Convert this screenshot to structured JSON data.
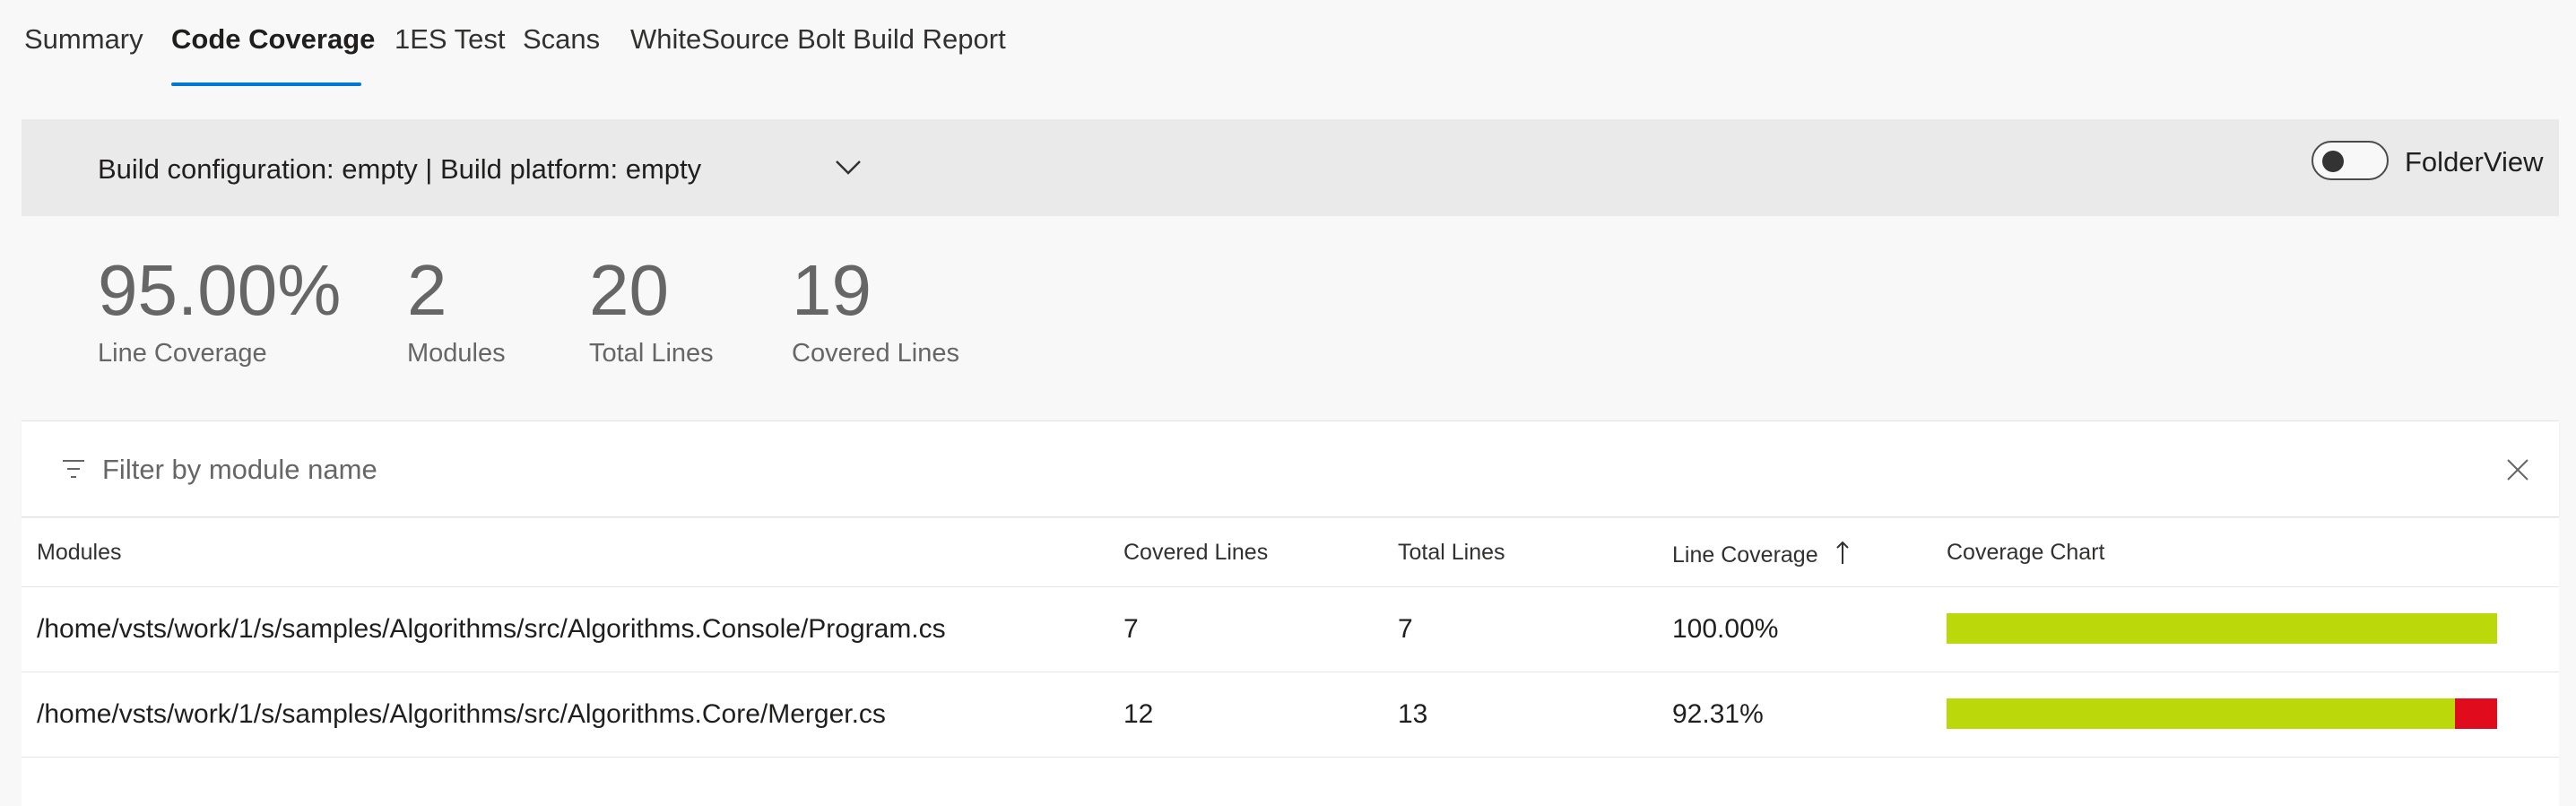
{
  "tabs": [
    {
      "label": "Summary",
      "active": false
    },
    {
      "label": "Code Coverage",
      "active": true
    },
    {
      "label": "1ES Test",
      "active": false
    },
    {
      "label": "Scans",
      "active": false
    },
    {
      "label": "WhiteSource Bolt Build Report",
      "active": false
    }
  ],
  "config": {
    "label": "Build configuration: empty | Build platform: empty",
    "icon": "chevron-down-icon"
  },
  "folder_view": {
    "label": "FolderView",
    "enabled": false
  },
  "stats": [
    {
      "value": "95.00%",
      "label": "Line Coverage"
    },
    {
      "value": "2",
      "label": "Modules"
    },
    {
      "value": "20",
      "label": "Total Lines"
    },
    {
      "value": "19",
      "label": "Covered Lines"
    }
  ],
  "filter": {
    "placeholder": "Filter by module name",
    "icon": "filter-icon",
    "clear_icon": "close-icon"
  },
  "table": {
    "headers": [
      "Modules",
      "Covered Lines",
      "Total Lines",
      "Line Coverage",
      "Coverage Chart"
    ],
    "sort_icon": "arrow-up-icon",
    "rows": [
      {
        "module": "/home/vsts/work/1/s/samples/Algorithms/src/Algorithms.Console/Program.cs",
        "covered": "7",
        "total": "7",
        "coverage": "100.00%",
        "covered_fraction": 1.0
      },
      {
        "module": "/home/vsts/work/1/s/samples/Algorithms/src/Algorithms.Core/Merger.cs",
        "covered": "12",
        "total": "13",
        "coverage": "92.31%",
        "covered_fraction": 0.9231
      }
    ]
  },
  "colors": {
    "accent": "#0078d4",
    "covered": "#bad80a",
    "uncovered": "#e00b1c"
  }
}
